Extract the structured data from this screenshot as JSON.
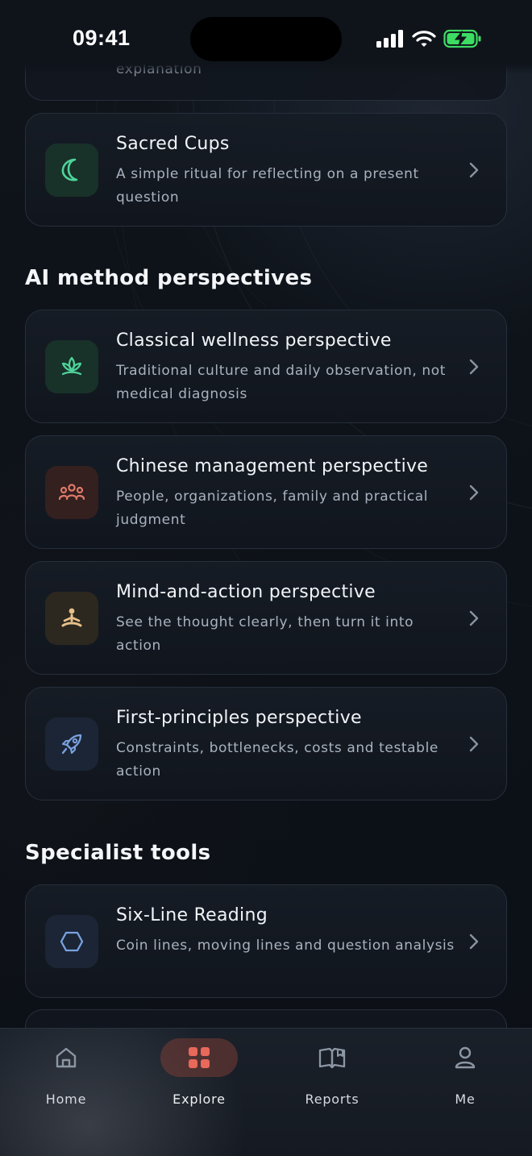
{
  "status_bar": {
    "time": "09:41"
  },
  "top_card_partial": {
    "text": "explanation"
  },
  "cards_top": [
    {
      "title": "Sacred Cups",
      "description": "A simple ritual for reflecting on a present question",
      "icon": "crescent-moon-icon",
      "accent": "#4fd39a"
    }
  ],
  "sections": [
    {
      "title": "AI method perspectives",
      "cards": [
        {
          "title": "Classical wellness perspective",
          "description": "Traditional culture and daily observation, not medical diagnosis",
          "icon": "lotus-icon",
          "accent": "#4fd39a"
        },
        {
          "title": "Chinese management perspective",
          "description": "People, organizations, family and practical judgment",
          "icon": "people-group-icon",
          "accent": "#e07a6a"
        },
        {
          "title": "Mind-and-action perspective",
          "description": "See the thought clearly, then turn it into action",
          "icon": "meditation-icon",
          "accent": "#e8c08a"
        },
        {
          "title": "First-principles perspective",
          "description": "Constraints, bottlenecks, costs and testable action",
          "icon": "rocket-icon",
          "accent": "#7aa2e0"
        }
      ]
    },
    {
      "title": "Specialist tools",
      "cards": [
        {
          "title": "Six-Line Reading",
          "description": "Coin lines, moving lines and question analysis",
          "icon": "hexagon-icon",
          "accent": "#7aa2e0"
        }
      ]
    }
  ],
  "tabs": [
    {
      "label": "Home",
      "icon": "home-icon",
      "active": false
    },
    {
      "label": "Explore",
      "icon": "grid-icon",
      "active": true
    },
    {
      "label": "Reports",
      "icon": "open-book-icon",
      "active": false
    },
    {
      "label": "Me",
      "icon": "person-icon",
      "active": false
    }
  ],
  "colors": {
    "background": "#0c1117",
    "card": "#161c25",
    "card_border": "#262f3b",
    "explore_accent": "#e8685a",
    "battery_green": "#3ddc63"
  }
}
